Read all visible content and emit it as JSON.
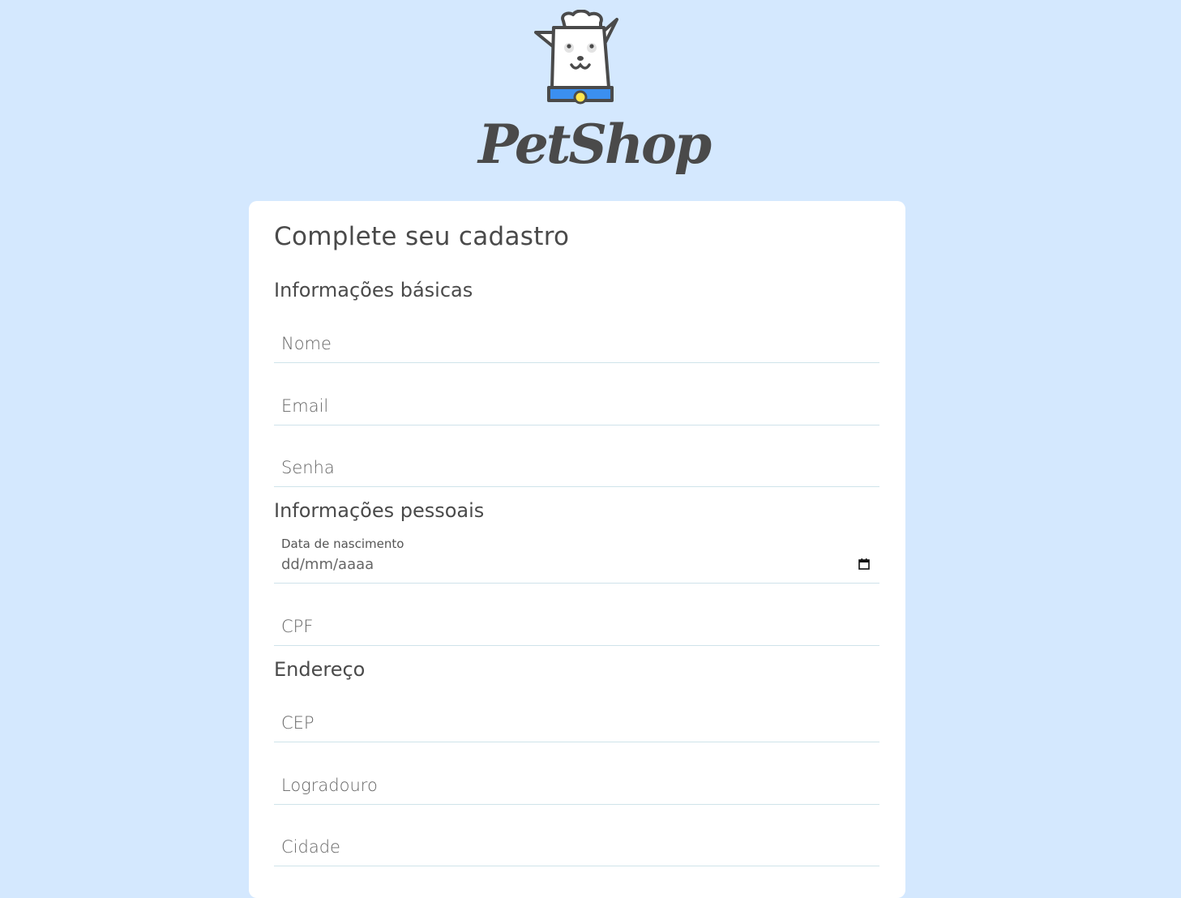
{
  "brand": {
    "name": "PetShop",
    "colors": {
      "background": "#d4e8fe",
      "card": "#ffffff",
      "text": "#4a4a4a",
      "collar": "#3b8ff0",
      "tag": "#ffe54d"
    }
  },
  "form": {
    "title": "Complete seu cadastro",
    "sections": {
      "basic": "Informações básicas",
      "personal": "Informações pessoais",
      "address": "Endereço"
    },
    "fields": {
      "nome": {
        "placeholder": "Nome",
        "value": ""
      },
      "email": {
        "placeholder": "Email",
        "value": ""
      },
      "senha": {
        "placeholder": "Senha",
        "value": ""
      },
      "nascimento": {
        "label": "Data de nascimento",
        "placeholder": "dd/mm/aaaa"
      },
      "cpf": {
        "placeholder": "CPF",
        "value": ""
      },
      "cep": {
        "placeholder": "CEP",
        "value": ""
      },
      "logradouro": {
        "placeholder": "Logradouro",
        "value": ""
      },
      "cidade": {
        "placeholder": "Cidade",
        "value": ""
      }
    }
  },
  "icons": {
    "logo": "dog-chef-icon",
    "calendar": "calendar-icon"
  }
}
